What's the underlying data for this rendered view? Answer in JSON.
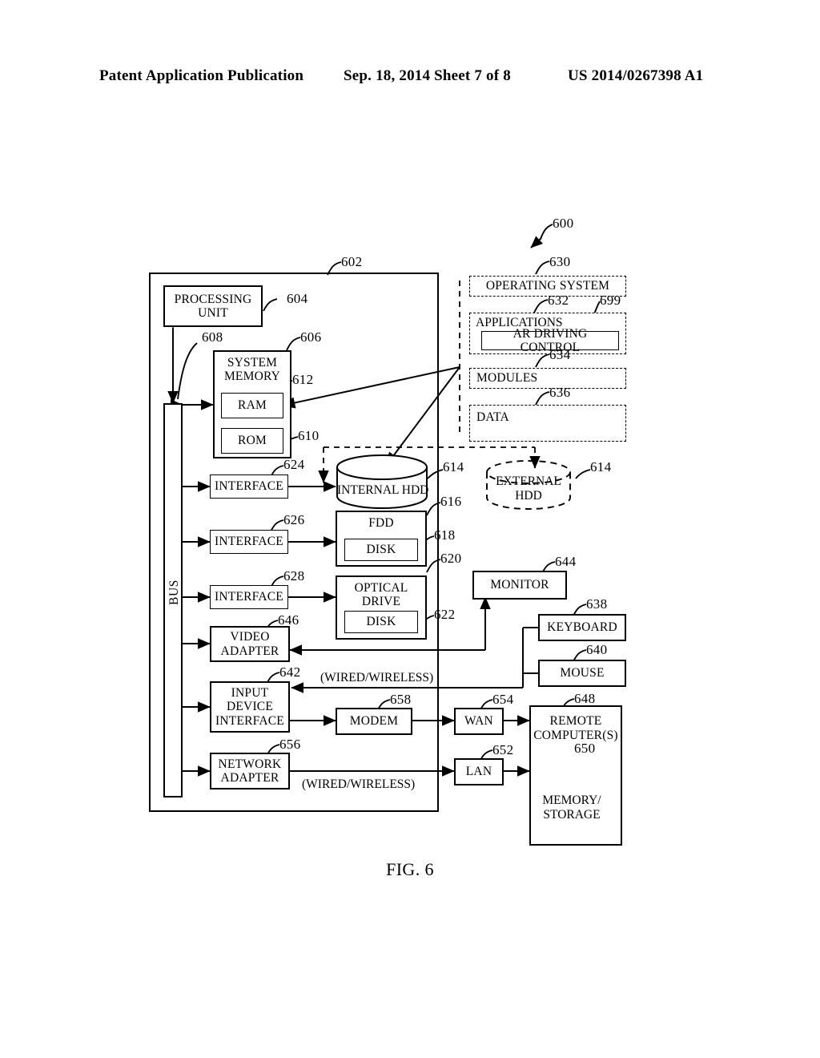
{
  "header": {
    "left": "Patent Application Publication",
    "middle": "Sep. 18, 2014  Sheet 7 of 8",
    "right": "US 2014/0267398 A1"
  },
  "figure": {
    "caption": "FIG. 6",
    "system_ref": "600"
  },
  "refs": {
    "computer_outer": "602",
    "processing_unit": "604",
    "system_memory": "606",
    "bus": "608",
    "rom": "610",
    "ram": "612",
    "hdd": "614",
    "hdd_external": "614",
    "fdd": "616",
    "fdd_disk": "618",
    "optical_drive": "620",
    "optical_disk": "622",
    "interface_hdd": "624",
    "interface_fdd": "626",
    "interface_optical": "628",
    "operating_system": "630",
    "applications": "632",
    "modules": "634",
    "data": "636",
    "keyboard": "638",
    "mouse": "640",
    "input_device_interface": "642",
    "monitor": "644",
    "video_adapter": "646",
    "remote_computers": "648",
    "remote_memory": "650",
    "lan": "652",
    "wan": "654",
    "network_adapter": "656",
    "modem": "658",
    "ar_driving_control": "699"
  },
  "blocks": {
    "processing_unit": "PROCESSING UNIT",
    "system_memory": "SYSTEM MEMORY",
    "ram": "RAM",
    "rom": "ROM",
    "bus": "BUS",
    "interface_1": "INTERFACE",
    "interface_2": "INTERFACE",
    "interface_3": "INTERFACE",
    "internal_hdd": "INTERNAL HDD",
    "external_hdd": "EXTERNAL HDD",
    "fdd": "FDD",
    "fdd_disk": "DISK",
    "optical_drive": "OPTICAL DRIVE",
    "optical_disk": "DISK",
    "video_adapter": "VIDEO ADAPTER",
    "input_device_interface": "INPUT DEVICE INTERFACE",
    "network_adapter": "NETWORK ADAPTER",
    "modem": "MODEM",
    "wan": "WAN",
    "lan": "LAN",
    "monitor": "MONITOR",
    "keyboard": "KEYBOARD",
    "mouse": "MOUSE",
    "remote_computers": "REMOTE COMPUTER(S)",
    "remote_memory": "MEMORY/ STORAGE",
    "operating_system": "OPERATING SYSTEM",
    "applications": "APPLICATIONS",
    "ar_driving_control": "AR DRIVING CONTROL",
    "modules": "MODULES",
    "data": "DATA"
  },
  "annotations": {
    "wired_wireless_top": "(WIRED/WIRELESS)",
    "wired_wireless_bottom": "(WIRED/WIRELESS)"
  },
  "colors": {
    "ink": "#000000",
    "paper": "#ffffff"
  }
}
